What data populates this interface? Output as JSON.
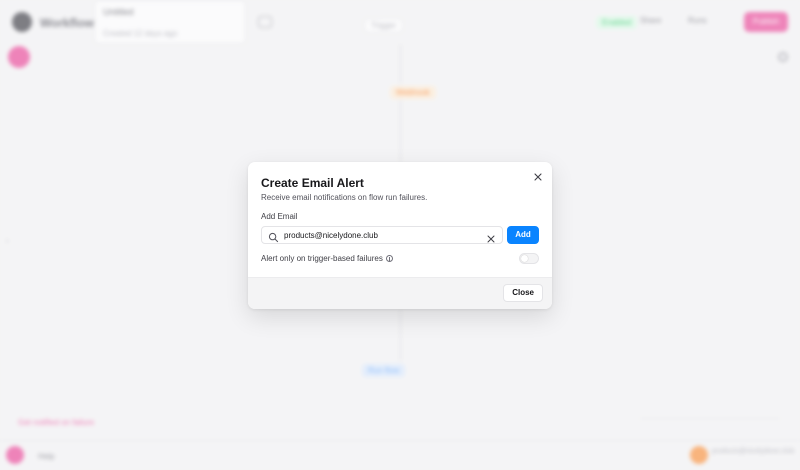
{
  "background": {
    "brand": "Workflow",
    "flow_dropdown": {
      "title": "Untitled",
      "subtitle": "Created 12 days ago"
    },
    "trigger_chip": "Trigger",
    "status": "Enabled",
    "action_1": "Share",
    "action_2": "Runs",
    "publish": "Publish",
    "node_orange": "Webhook",
    "node_blue": "Run flow",
    "bottom_link": "Get notified on failure",
    "help": "Help",
    "user_name": "products@nicelydone.club"
  },
  "modal": {
    "title": "Create Email Alert",
    "description": "Receive email notifications on flow run failures.",
    "field_label": "Add Email",
    "email_value": "products@nicelydone.club",
    "add_label": "Add",
    "toggle_label": "Alert only on trigger-based failures",
    "toggle_on": false,
    "close_label": "Close"
  },
  "colors": {
    "accent_blue": "#0a84ff",
    "brand_pink": "#ec4899"
  },
  "icons": {
    "search": "search-icon",
    "clear": "clear-icon",
    "close": "close-icon",
    "info": "info-icon"
  }
}
